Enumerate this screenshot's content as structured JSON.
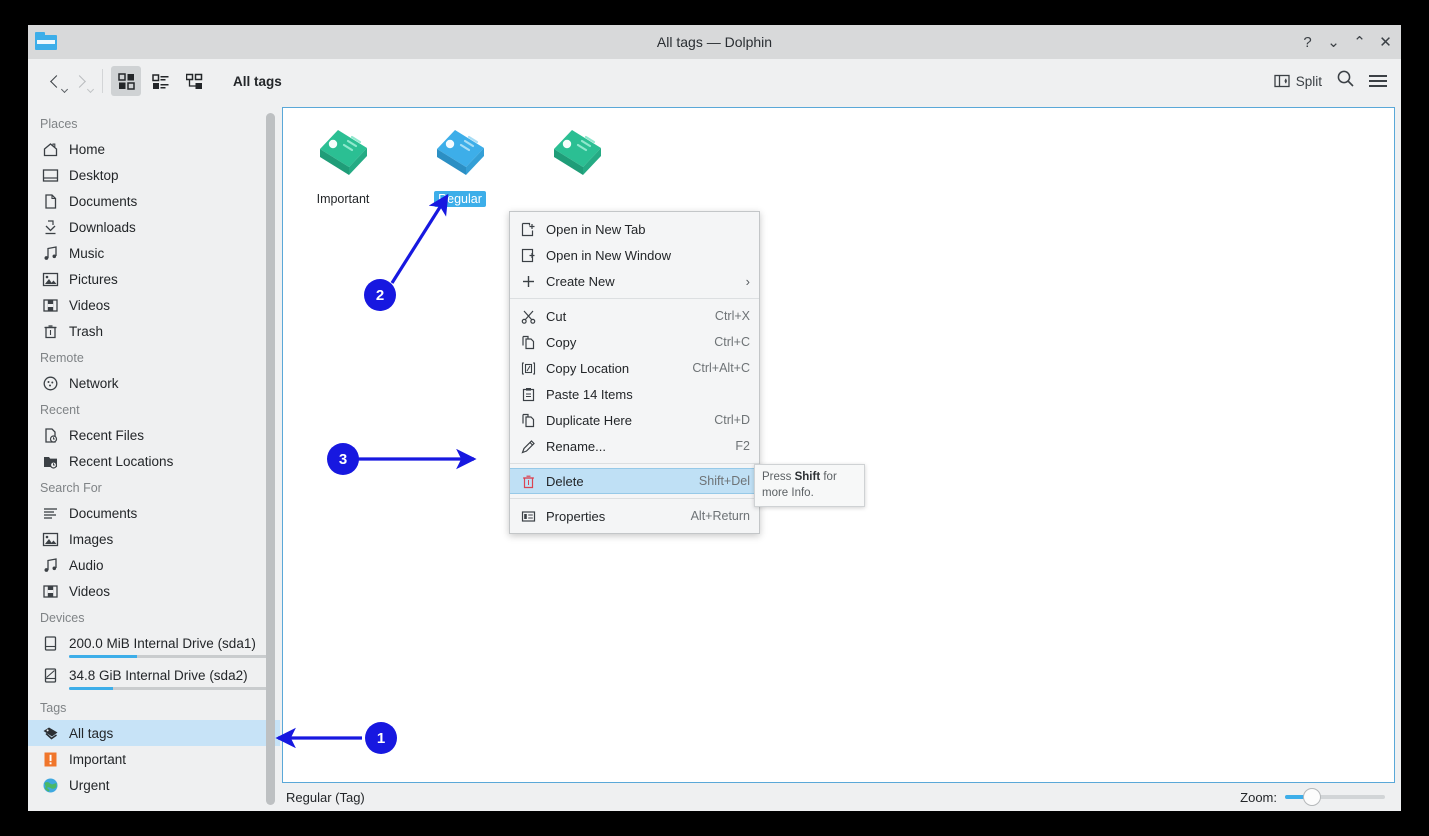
{
  "window": {
    "title": "All tags — Dolphin",
    "app_icon": "folder-icon",
    "buttons": {
      "help": "?",
      "minimize": "⌄",
      "maximize": "⌃",
      "close": "✕"
    }
  },
  "toolbar": {
    "back_label": "Back",
    "forward_label": "Forward",
    "view_modes": [
      {
        "name": "icons-view",
        "label": "Icons",
        "active": true
      },
      {
        "name": "compact-view",
        "label": "Compact",
        "active": false
      },
      {
        "name": "details-view",
        "label": "Details",
        "active": false
      }
    ],
    "location": "All tags",
    "split_label": "Split",
    "search_label": "Search",
    "menu_label": "Menu"
  },
  "sidebar": {
    "sections": [
      {
        "title": "Places",
        "items": [
          {
            "label": "Home",
            "icon": "home-icon"
          },
          {
            "label": "Desktop",
            "icon": "desktop-icon"
          },
          {
            "label": "Documents",
            "icon": "document-icon"
          },
          {
            "label": "Downloads",
            "icon": "download-icon"
          },
          {
            "label": "Music",
            "icon": "music-icon"
          },
          {
            "label": "Pictures",
            "icon": "picture-icon"
          },
          {
            "label": "Videos",
            "icon": "video-icon"
          },
          {
            "label": "Trash",
            "icon": "trash-icon"
          }
        ]
      },
      {
        "title": "Remote",
        "items": [
          {
            "label": "Network",
            "icon": "network-icon"
          }
        ]
      },
      {
        "title": "Recent",
        "items": [
          {
            "label": "Recent Files",
            "icon": "recent-file-icon"
          },
          {
            "label": "Recent Locations",
            "icon": "recent-folder-icon"
          }
        ]
      },
      {
        "title": "Search For",
        "items": [
          {
            "label": "Documents",
            "icon": "search-documents-icon"
          },
          {
            "label": "Images",
            "icon": "search-images-icon"
          },
          {
            "label": "Audio",
            "icon": "search-audio-icon"
          },
          {
            "label": "Videos",
            "icon": "search-videos-icon"
          }
        ]
      },
      {
        "title": "Devices",
        "devices": [
          {
            "label": "200.0 MiB Internal Drive (sda1)",
            "icon": "drive-icon",
            "fill_percent": 34
          },
          {
            "label": "34.8 GiB Internal Drive (sda2)",
            "icon": "drive-partition-icon",
            "fill_percent": 22
          }
        ]
      },
      {
        "title": "Tags",
        "items": [
          {
            "label": "All tags",
            "icon": "tag-icon",
            "selected": true
          },
          {
            "label": "Important",
            "icon": "important-icon"
          },
          {
            "label": "Urgent",
            "icon": "urgent-globe-icon"
          }
        ]
      }
    ]
  },
  "view": {
    "files": [
      {
        "label": "Important",
        "icon": "tag-3d-icon",
        "color": "#2bbf93",
        "selected": false
      },
      {
        "label": "Regular",
        "icon": "tag-3d-icon",
        "color": "#3daee9",
        "selected": true
      },
      {
        "label": "",
        "icon": "tag-3d-icon",
        "color": "#2bbf93",
        "selected": false
      }
    ]
  },
  "context_menu": {
    "groups": [
      [
        {
          "label": "Open in New Tab",
          "shortcut": "",
          "icon": "new-tab-icon"
        },
        {
          "label": "Open in New Window",
          "shortcut": "",
          "icon": "new-window-icon"
        },
        {
          "label": "Create New",
          "shortcut": "",
          "icon": "plus-icon",
          "submenu": true
        }
      ],
      [
        {
          "label": "Cut",
          "shortcut": "Ctrl+X",
          "icon": "scissors-icon"
        },
        {
          "label": "Copy",
          "shortcut": "Ctrl+C",
          "icon": "copy-icon"
        },
        {
          "label": "Copy Location",
          "shortcut": "Ctrl+Alt+C",
          "icon": "copy-location-icon"
        },
        {
          "label": "Paste 14 Items",
          "shortcut": "",
          "icon": "clipboard-icon"
        },
        {
          "label": "Duplicate Here",
          "shortcut": "Ctrl+D",
          "icon": "duplicate-icon"
        },
        {
          "label": "Rename...",
          "shortcut": "F2",
          "icon": "pencil-icon"
        }
      ],
      [
        {
          "label": "Delete",
          "shortcut": "Shift+Del",
          "icon": "trash-red-icon",
          "highlighted": true
        }
      ],
      [
        {
          "label": "Properties",
          "shortcut": "Alt+Return",
          "icon": "properties-icon"
        }
      ]
    ]
  },
  "tooltip": {
    "prefix": "Press ",
    "bold": "Shift",
    "suffix": " for more Info."
  },
  "statusbar": {
    "text": "Regular (Tag)",
    "zoom_label": "Zoom:",
    "zoom_percent": 22
  },
  "annotations": {
    "badges": [
      {
        "number": "1",
        "target": "sidebar-item-all-tags"
      },
      {
        "number": "2",
        "target": "file-item-regular"
      },
      {
        "number": "3",
        "target": "context-menu-delete"
      }
    ],
    "color": "#1718e0"
  }
}
